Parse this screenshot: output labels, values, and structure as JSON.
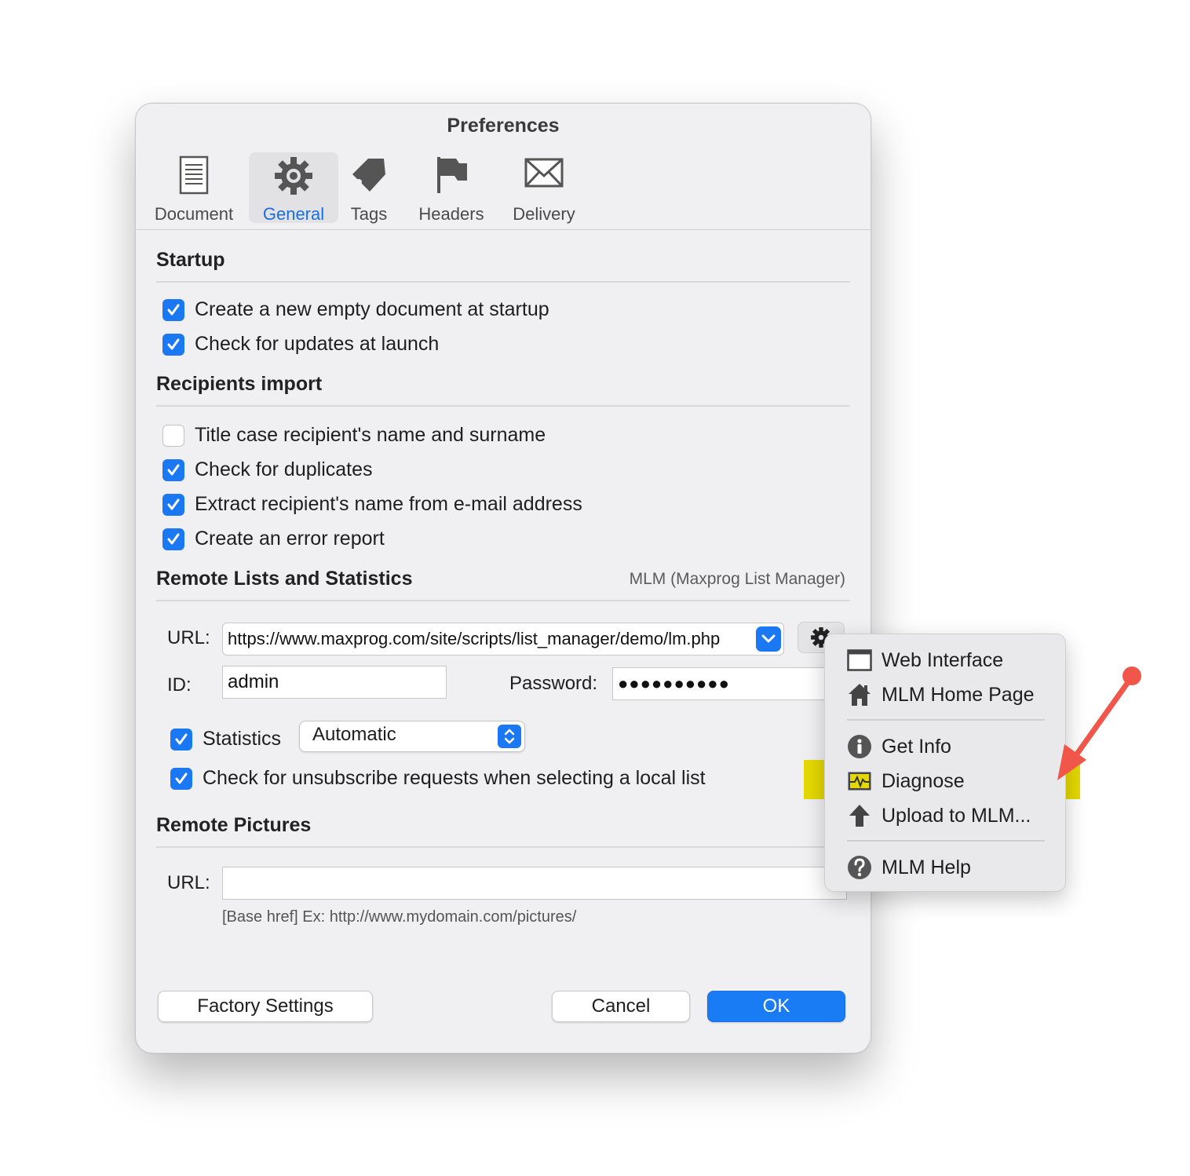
{
  "window": {
    "title": "Preferences"
  },
  "tabs": [
    {
      "label": "Document",
      "icon": "document-icon",
      "selected": false
    },
    {
      "label": "General",
      "icon": "gear-icon",
      "selected": true
    },
    {
      "label": "Tags",
      "icon": "tag-icon",
      "selected": false
    },
    {
      "label": "Headers",
      "icon": "flag-icon",
      "selected": false
    },
    {
      "label": "Delivery",
      "icon": "envelope-icon",
      "selected": false
    }
  ],
  "startup": {
    "title": "Startup",
    "options": [
      {
        "label": "Create a new empty document at startup",
        "checked": true
      },
      {
        "label": "Check for updates at launch",
        "checked": true
      }
    ]
  },
  "recipients_import": {
    "title": "Recipients import",
    "options": [
      {
        "label": "Title case recipient's name and surname",
        "checked": false
      },
      {
        "label": "Check for duplicates",
        "checked": true
      },
      {
        "label": "Extract recipient's name from e-mail address",
        "checked": true
      },
      {
        "label": "Create an error report",
        "checked": true
      }
    ]
  },
  "remote_lists": {
    "title": "Remote Lists and Statistics",
    "note": "MLM (Maxprog List Manager)",
    "url_label": "URL:",
    "url_value": "https://www.maxprog.com/site/scripts/list_manager/demo/lm.php",
    "id_label": "ID:",
    "id_value": "admin",
    "password_label": "Password:",
    "password_value": "●●●●●●●●●●",
    "statistics_label": "Statistics",
    "statistics_checked": true,
    "statistics_mode": "Automatic",
    "unsubscribe_label": "Check for unsubscribe requests when selecting a local list",
    "unsubscribe_checked": true
  },
  "remote_pictures": {
    "title": "Remote Pictures",
    "url_label": "URL:",
    "url_value": "",
    "hint": "[Base href] Ex: http://www.mydomain.com/pictures/"
  },
  "buttons": {
    "factory": "Factory Settings",
    "cancel": "Cancel",
    "ok": "OK"
  },
  "menu": {
    "items": [
      {
        "label": "Web Interface",
        "icon": "window-icon"
      },
      {
        "label": "MLM Home Page",
        "icon": "home-icon"
      },
      {
        "label": "Get Info",
        "icon": "info-icon"
      },
      {
        "label": "Diagnose",
        "icon": "diagnose-icon",
        "highlighted": true
      },
      {
        "label": "Upload to MLM...",
        "icon": "upload-arrow-icon"
      },
      {
        "label": "MLM Help",
        "icon": "help-icon"
      }
    ]
  },
  "colors": {
    "accent": "#1978f2",
    "highlight": "#e5d800",
    "annotation_arrow": "#f0564a"
  }
}
